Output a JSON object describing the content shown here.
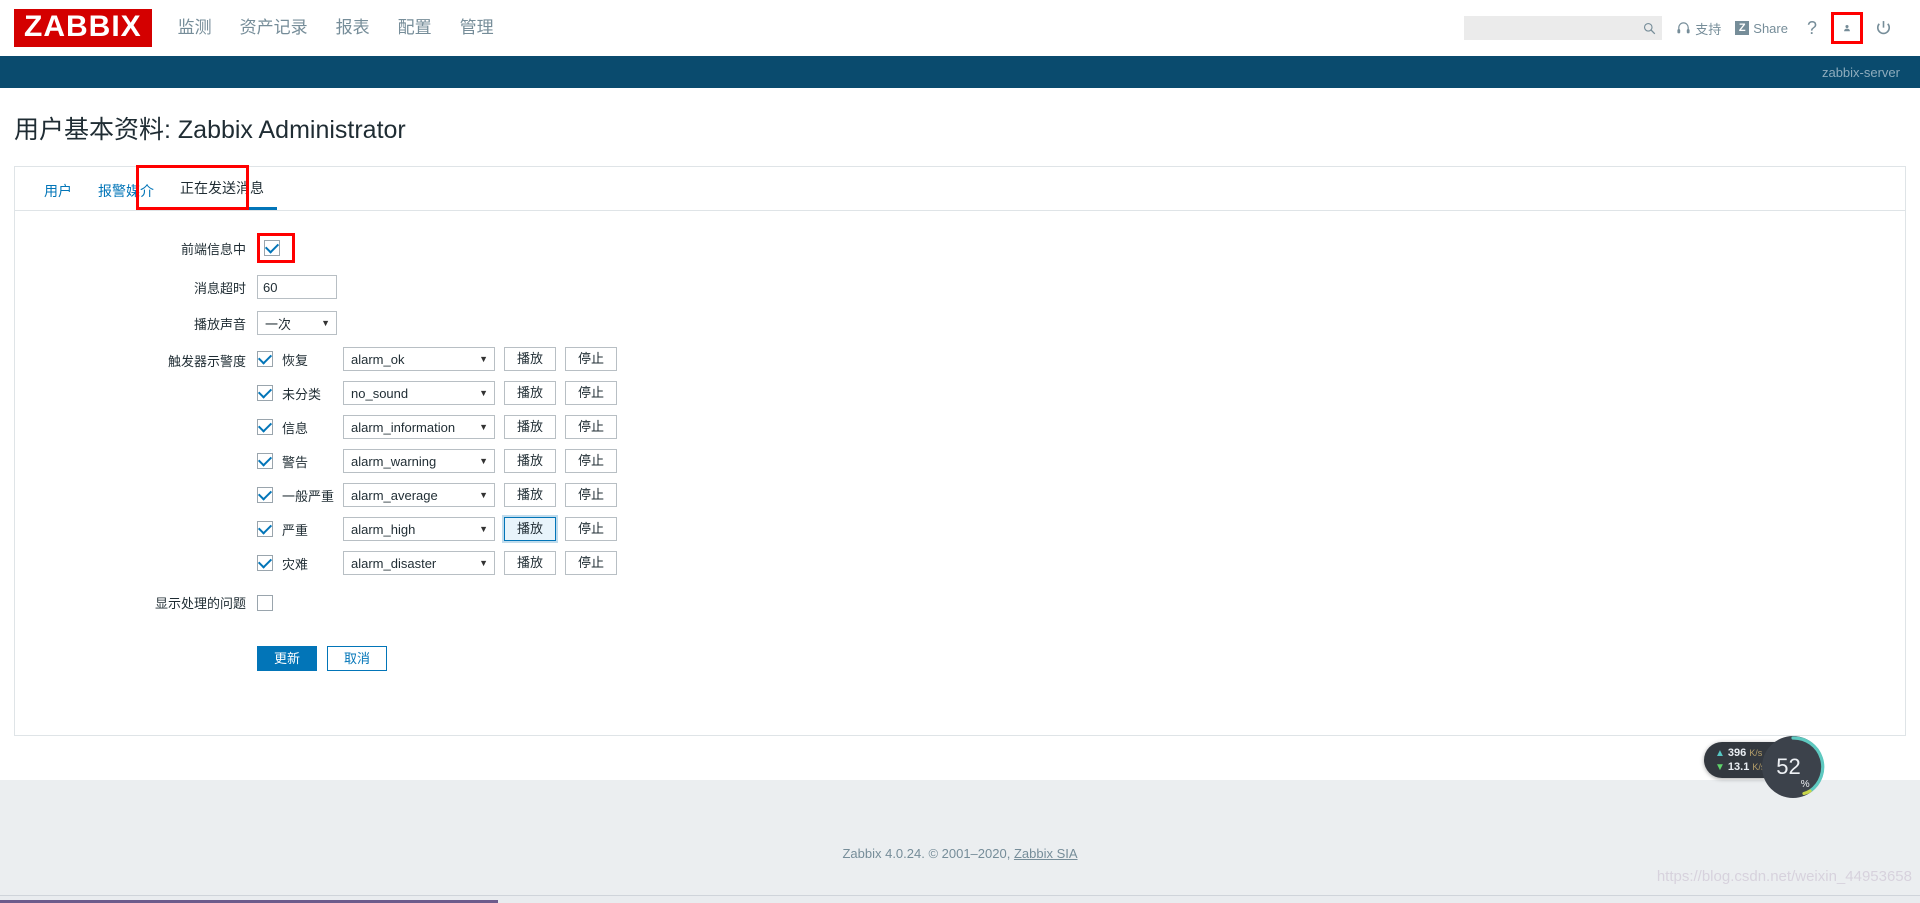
{
  "header": {
    "logo": "ZABBIX",
    "nav": [
      {
        "label": "监测"
      },
      {
        "label": "资产记录"
      },
      {
        "label": "报表"
      },
      {
        "label": "配置"
      },
      {
        "label": "管理"
      }
    ],
    "search_placeholder": "",
    "search_value": "",
    "support_label": "支持",
    "share_label": "Share",
    "share_badge": "Z",
    "help_label": "?",
    "server_name": "zabbix-server"
  },
  "page": {
    "title": "用户基本资料: Zabbix Administrator"
  },
  "tabs": [
    {
      "label": "用户",
      "active": false
    },
    {
      "label": "报警媒介",
      "active": false
    },
    {
      "label": "正在发送消息",
      "active": true
    }
  ],
  "form": {
    "frontend_messaging": {
      "label": "前端信息中",
      "checked": true
    },
    "message_timeout": {
      "label": "消息超时",
      "value": "60"
    },
    "play_sound": {
      "label": "播放声音",
      "value": "一次"
    },
    "trigger_severity": {
      "label": "触发器示警度",
      "play_label": "播放",
      "stop_label": "停止",
      "rows": [
        {
          "name": "恢复",
          "checked": true,
          "sound": "alarm_ok",
          "play_focused": false
        },
        {
          "name": "未分类",
          "checked": true,
          "sound": "no_sound",
          "play_focused": false
        },
        {
          "name": "信息",
          "checked": true,
          "sound": "alarm_information",
          "play_focused": false
        },
        {
          "name": "警告",
          "checked": true,
          "sound": "alarm_warning",
          "play_focused": false
        },
        {
          "name": "一般严重",
          "checked": true,
          "sound": "alarm_average",
          "play_focused": false
        },
        {
          "name": "严重",
          "checked": true,
          "sound": "alarm_high",
          "play_focused": true
        },
        {
          "name": "灾难",
          "checked": true,
          "sound": "alarm_disaster",
          "play_focused": false
        }
      ]
    },
    "show_suppressed": {
      "label": "显示处理的问题",
      "checked": false
    },
    "update_label": "更新",
    "cancel_label": "取消"
  },
  "widget": {
    "upload_value": "396",
    "upload_unit": "K/s",
    "download_value": "13.1",
    "download_unit": "K/s",
    "gauge_value": "52",
    "gauge_unit": "%"
  },
  "footer": {
    "text": "Zabbix 4.0.24. © 2001–2020, ",
    "link": "Zabbix SIA",
    "watermark": "https://blog.csdn.net/weixin_44953658"
  },
  "colors": {
    "brand_red": "#d40000",
    "accent_blue": "#0275b8",
    "dark_bar": "#0a4b6e",
    "highlight_red": "#ff0000"
  }
}
